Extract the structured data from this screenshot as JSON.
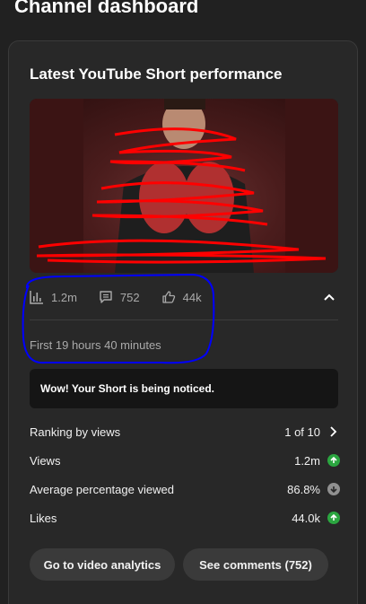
{
  "page": {
    "title": "Channel dashboard"
  },
  "card": {
    "title": "Latest YouTube Short performance",
    "stats": {
      "views": "1.2m",
      "comments": "752",
      "likes": "44k"
    },
    "first_period": "First 19 hours 40 minutes",
    "notice": "Wow! Your Short is being noticed.",
    "metrics": {
      "ranking": {
        "label": "Ranking by views",
        "value": "1 of 10"
      },
      "views": {
        "label": "Views",
        "value": "1.2m",
        "trend": "up"
      },
      "avg_pct": {
        "label": "Average percentage viewed",
        "value": "86.8%",
        "trend": "down"
      },
      "likes": {
        "label": "Likes",
        "value": "44.0k",
        "trend": "up"
      }
    },
    "buttons": {
      "analytics": "Go to video analytics",
      "comments": "See comments (752)"
    }
  },
  "colors": {
    "up": "#2ba640",
    "down": "#909090",
    "annotation": "#0000ff",
    "scribble": "#ff0000"
  },
  "icons": [
    "bar-chart-icon",
    "comment-icon",
    "thumbs-up-icon",
    "chevron-up-icon",
    "chevron-right-icon",
    "arrow-up-icon",
    "arrow-down-icon"
  ]
}
